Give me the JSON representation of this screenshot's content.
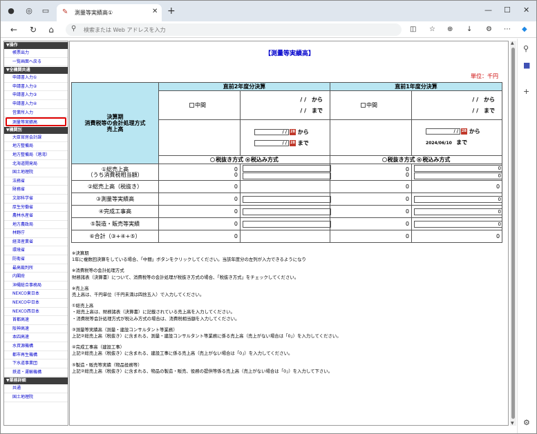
{
  "browser": {
    "tab_title": "測量等実績高①",
    "address_placeholder": "検索または Web アドレスを入力"
  },
  "sidebar": {
    "sections": [
      {
        "title": "▼操作",
        "items": [
          "帳票出力",
          "一覧画面へ戻る"
        ]
      },
      {
        "title": "▼全機関共通",
        "items": [
          "申請書入力①",
          "申請書入力②",
          "申請書入力③",
          "申請書入力④",
          "営業所入力",
          "測量等実績高"
        ]
      },
      {
        "title": "▼機関別",
        "items": [
          "大臣官房会計課",
          "地方整備局",
          "地方整備局（港湾）",
          "北海道開発局",
          "国土地理院",
          "法務省",
          "財務省",
          "文部科学省",
          "厚生労働省",
          "農林水産省",
          "地方農政局",
          "林野庁",
          "経済産業省",
          "環境省",
          "防衛省",
          "最高裁判所",
          "内閣府",
          "沖縄総合事務局",
          "NEXCO東日本",
          "NEXCO中日本",
          "NEXCO西日本",
          "首都高速",
          "阪神高速",
          "本四高速",
          "水資源機構",
          "都市再生機構",
          "下水道事業団",
          "鉄道・運輸機構"
        ]
      },
      {
        "title": "▼業務詳細",
        "items": [
          "共通",
          "国土地理院"
        ]
      }
    ]
  },
  "page": {
    "title": "【測量等実績高】",
    "unit": "単位：千円",
    "period_label": "決算期\n消費税等の会計処理方式\n売上高",
    "col_prev2": "直前2年度分決算",
    "col_prev1": "直前1年度分決算",
    "chuukan": "中間",
    "date_from": "/ /　から",
    "date_to": "/ /　まで",
    "kara": "から",
    "made": "まで",
    "prev1_end_date": "2024/06/10",
    "date_placeholder": "/ /",
    "tax_excl": "税抜き方式",
    "tax_incl": "税込み方式"
  },
  "rows": [
    {
      "label": "①総売上高\n（うち消費税相当額）",
      "v1": "0\n0",
      "v2": "0\n0",
      "input1": true,
      "input2": true
    },
    {
      "label": "②総売上高（税抜き）",
      "v1": "0",
      "v2": "0",
      "input1": false,
      "input2": false
    },
    {
      "label": "③測量等実績高",
      "v1": "0",
      "v2": "0",
      "input1": true,
      "input2": true
    },
    {
      "label": "④完成工事高",
      "v1": "0",
      "v2": "0",
      "input1": true,
      "input2": true
    },
    {
      "label": "⑤製造・販売等実績",
      "v1": "0",
      "v2": "0",
      "input1": true,
      "input2": true
    },
    {
      "label": "⑥合計（③+④+⑤）",
      "v1": "0",
      "v2": "0",
      "input1": false,
      "input2": false
    }
  ],
  "row_input_values": {
    "r0": "0\n0",
    "r2": "0",
    "r3": "0",
    "r4": "0"
  },
  "notes": [
    "※決算期",
    "1年に複数回決算をしている場合、「中間」ボタンをクリックしてください。当該年度分の左列が入力できるようになり",
    "",
    "※消費税等の会計処理方式",
    "財務諸表（決算書）について、消費税等の会計処理が税抜き方式の場合、「税抜き方式」をチェックしてください。",
    "",
    "※売上高",
    "売上高は、千円単位（千円未満は四捨五入）で入力してください。",
    "",
    "①総売上高",
    "・総売上高は、財務諸表（決算書）に記載されている売上高を入力してください。",
    "・消費税等会計処理方式が税込み方式の場合は、消費税相当額を入力してください。",
    "",
    "③測量等実績高（測量・建設コンサルタント等業務）",
    "上記②総売上高（税抜き）に含まれる、測量・建設コンサルタント等業務に係る売上高（売上がない場合は「0」）を入力してください。",
    "",
    "④完成工事高（建設工事）",
    "上記②総売上高（税抜き）に含まれる、建設工事に係る売上高（売上がない場合は「0」）を入力してください。",
    "",
    "⑤製造・販売等実績（物品役務等）",
    "上記②総売上高（税抜き）に含まれる、物品の製造・販売、役務の提供等係る売上高（売上がない場合は「0」）を入力して下さい。"
  ]
}
